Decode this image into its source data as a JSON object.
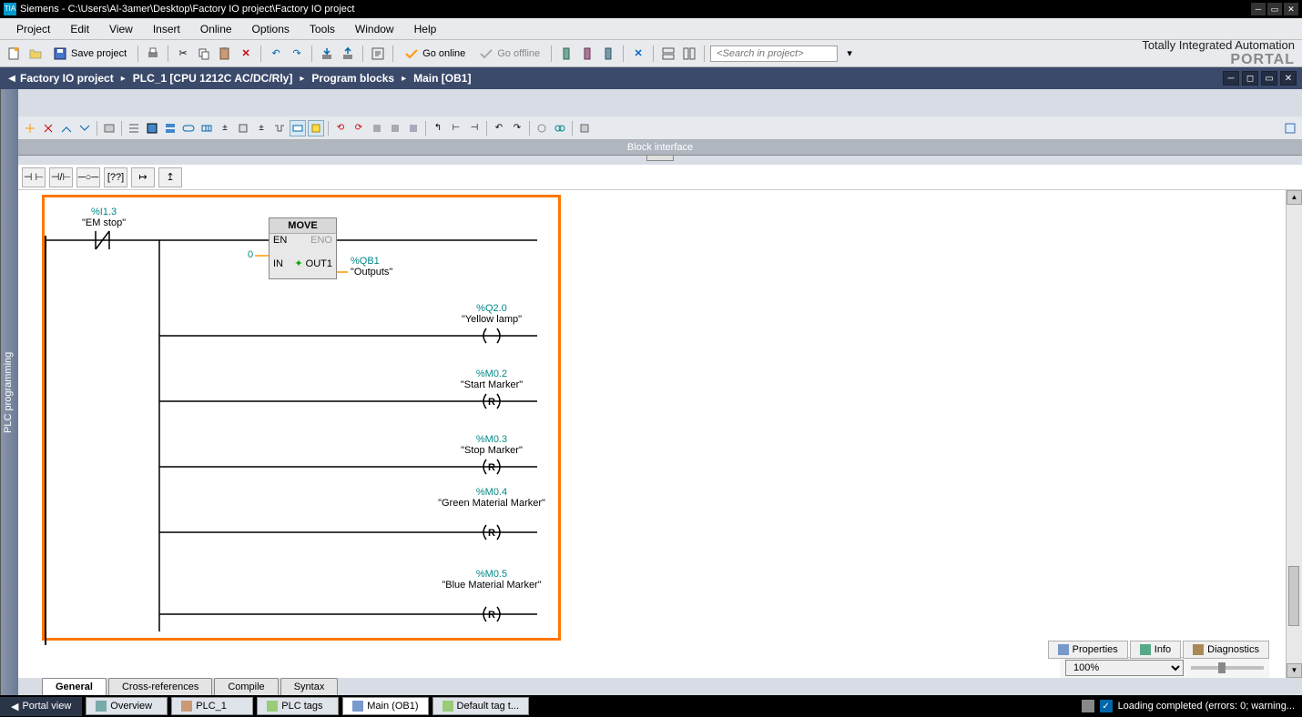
{
  "titlebar": {
    "icon_text": "TIA",
    "text": "Siemens  -  C:\\Users\\Al-3amer\\Desktop\\Factory IO project\\Factory IO project"
  },
  "menubar": [
    "Project",
    "Edit",
    "View",
    "Insert",
    "Online",
    "Options",
    "Tools",
    "Window",
    "Help"
  ],
  "toolbar": {
    "save_label": "Save project",
    "go_online": "Go online",
    "go_offline": "Go offline",
    "search_placeholder": "<Search in project>"
  },
  "branding": {
    "line1": "Totally Integrated Automation",
    "line2": "PORTAL"
  },
  "breadcrumb": {
    "items": [
      "Factory IO project",
      "PLC_1 [CPU 1212C AC/DC/Rly]",
      "Program blocks",
      "Main [OB1]"
    ]
  },
  "side_tab": "PLC programming",
  "block_interface": "Block interface",
  "ladder": {
    "contact": {
      "addr": "%I1.3",
      "sym": "\"EM stop\""
    },
    "move": {
      "title": "MOVE",
      "en": "EN",
      "eno": "ENO",
      "in": "IN",
      "in_val": "0",
      "out1": "OUT1",
      "out_addr": "%QB1",
      "out_sym": "\"Outputs\""
    },
    "rungs": [
      {
        "addr": "%Q2.0",
        "sym": "\"Yellow lamp\"",
        "type": "coil"
      },
      {
        "addr": "%M0.2",
        "sym": "\"Start Marker\"",
        "type": "R"
      },
      {
        "addr": "%M0.3",
        "sym": "\"Stop Marker\"",
        "type": "R"
      },
      {
        "addr": "%M0.4",
        "sym": "\"Green Material Marker\"",
        "type": "R"
      },
      {
        "addr": "%M0.5",
        "sym": "\"Blue Material Marker\"",
        "type": "R"
      }
    ]
  },
  "zoom": "100%",
  "bottom_tabs_right": [
    {
      "label": "Properties",
      "icon": "props"
    },
    {
      "label": "Info",
      "icon": "info"
    },
    {
      "label": "Diagnostics",
      "icon": "diag"
    }
  ],
  "bottom_tabs_left": [
    "General",
    "Cross-references",
    "Compile",
    "Syntax"
  ],
  "status": {
    "portal": "Portal view",
    "tabs": [
      {
        "label": "Overview"
      },
      {
        "label": "PLC_1"
      },
      {
        "label": "PLC tags"
      },
      {
        "label": "Main (OB1)",
        "active": true
      },
      {
        "label": "Default tag t..."
      }
    ],
    "message": "Loading completed (errors: 0; warning..."
  }
}
